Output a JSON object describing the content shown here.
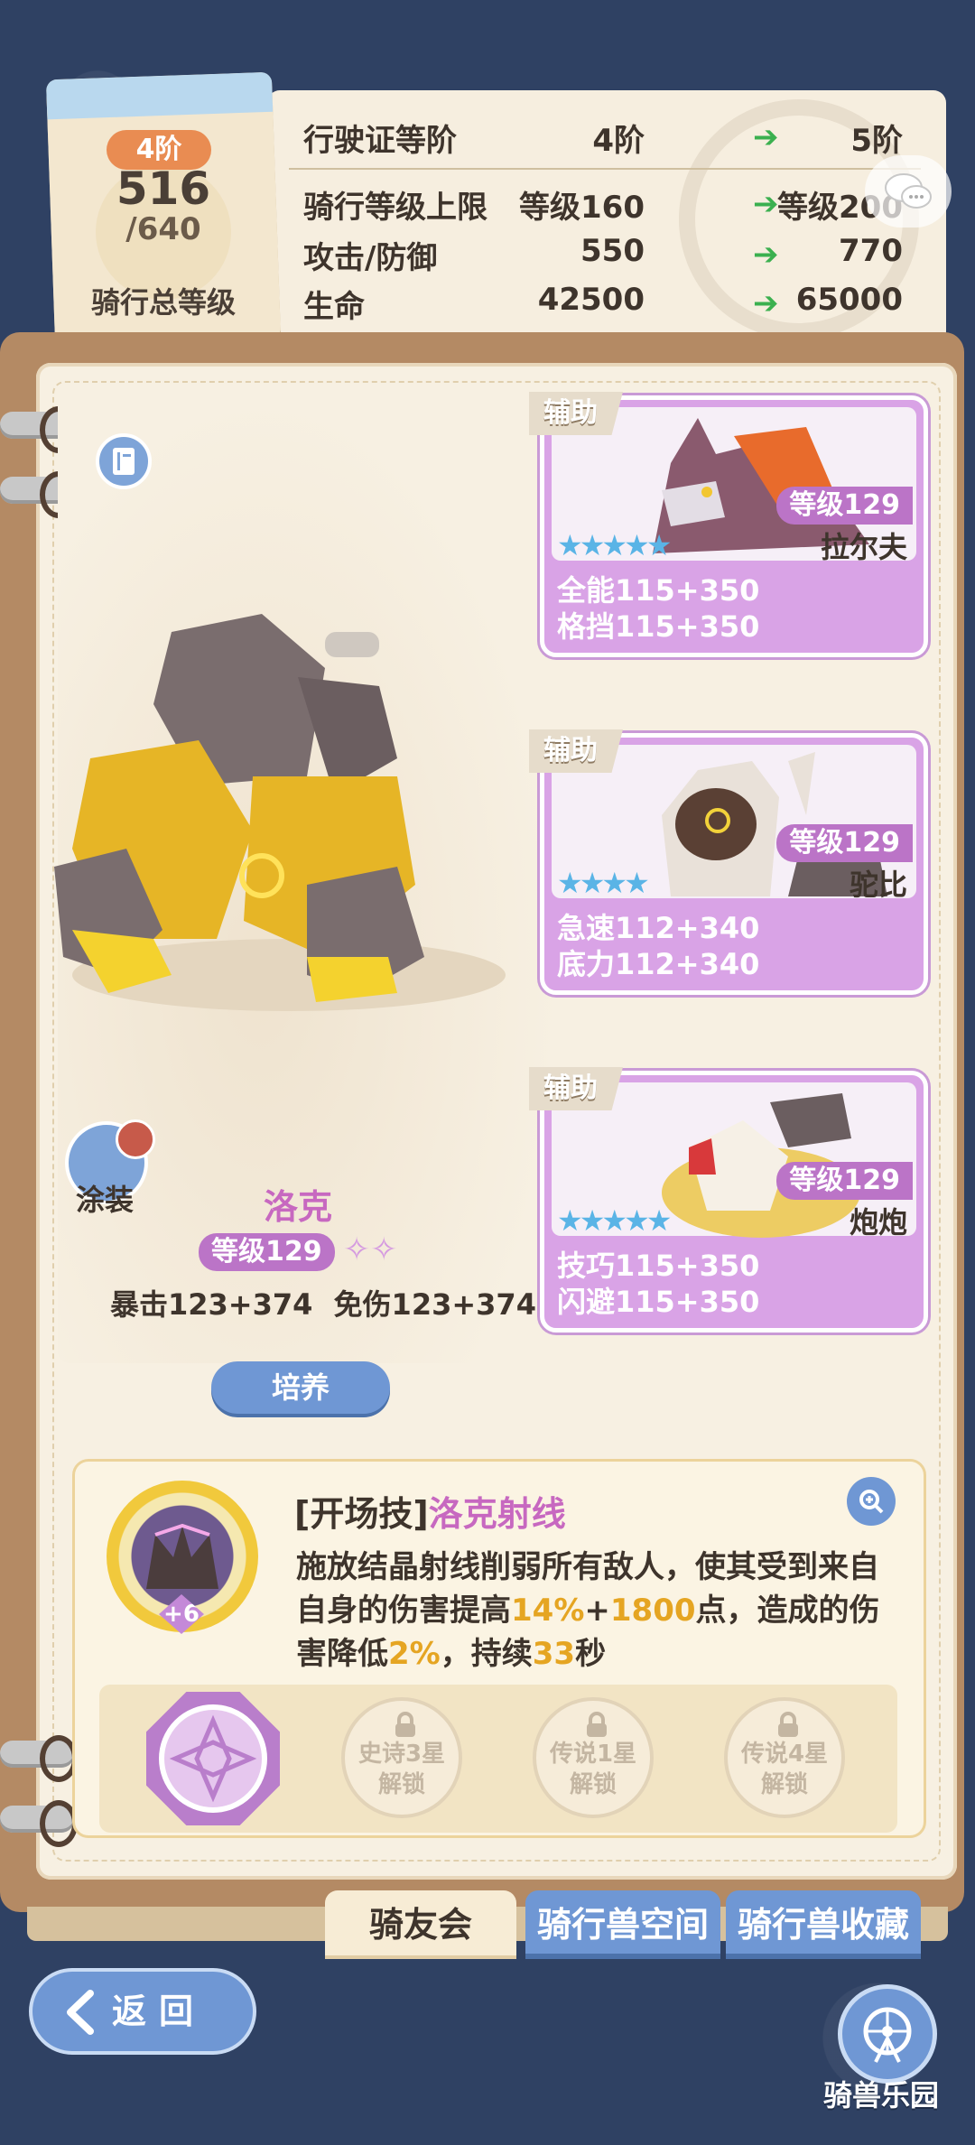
{
  "header": {
    "rank_pill": "4阶",
    "rank_current": "516",
    "rank_max": "/640",
    "rank_title": "骑行总等级",
    "rows": [
      {
        "label": "行驶证等阶",
        "from": "4阶",
        "to": "5阶"
      },
      {
        "label": "骑行等级上限",
        "from": "等级160",
        "to": "等级200"
      },
      {
        "label": "攻击/防御",
        "from": "550",
        "to": "770"
      },
      {
        "label": "生命",
        "from": "42500",
        "to": "65000"
      }
    ]
  },
  "mount": {
    "skin_label": "涂装",
    "name": "洛克",
    "level": "等级129",
    "stats": "暴击123+374 免伤123+374",
    "cultivate_label": "培养"
  },
  "assists": [
    {
      "tag": "辅助",
      "level": "等级129",
      "name": "拉尔夫",
      "stars": "★★★★★",
      "stat1": "全能115+350",
      "stat2": "格挡115+350"
    },
    {
      "tag": "辅助",
      "level": "等级129",
      "name": "驼比",
      "stars": "★★★★",
      "stat1": "急速112+340",
      "stat2": "底力112+340"
    },
    {
      "tag": "辅助",
      "level": "等级129",
      "name": "炮炮",
      "stars": "★★★★★",
      "stat1": "技巧115+350",
      "stat2": "闪避115+350"
    }
  ],
  "skill": {
    "tag": "[开场技]",
    "name": "洛克射线",
    "plus": "+6",
    "desc_1": "施放结晶射线削弱所有敌人，使其受到来自自身的伤害提高",
    "desc_hl_1": "14%",
    "desc_plus": "+",
    "desc_hl_2": "1800",
    "desc_2": "点，造成的伤害降低",
    "desc_hl_3": "2%",
    "desc_3": "，持续",
    "desc_hl_4": "33",
    "desc_4": "秒",
    "locked_runes": [
      {
        "line1": "史诗3星",
        "line2": "解锁"
      },
      {
        "line1": "传说1星",
        "line2": "解锁"
      },
      {
        "line1": "传说4星",
        "line2": "解锁"
      }
    ]
  },
  "tabs": {
    "friends": "骑友会",
    "space": "骑行兽空间",
    "collection": "骑行兽收藏"
  },
  "nav": {
    "back": "返回",
    "park": "骑兽乐园"
  },
  "colors": {
    "background": "#2f4163",
    "accent_purple": "#bb74c7",
    "accent_blue": "#6f97d4",
    "highlight": "#e5a522",
    "arrow_green": "#3bb04f"
  }
}
